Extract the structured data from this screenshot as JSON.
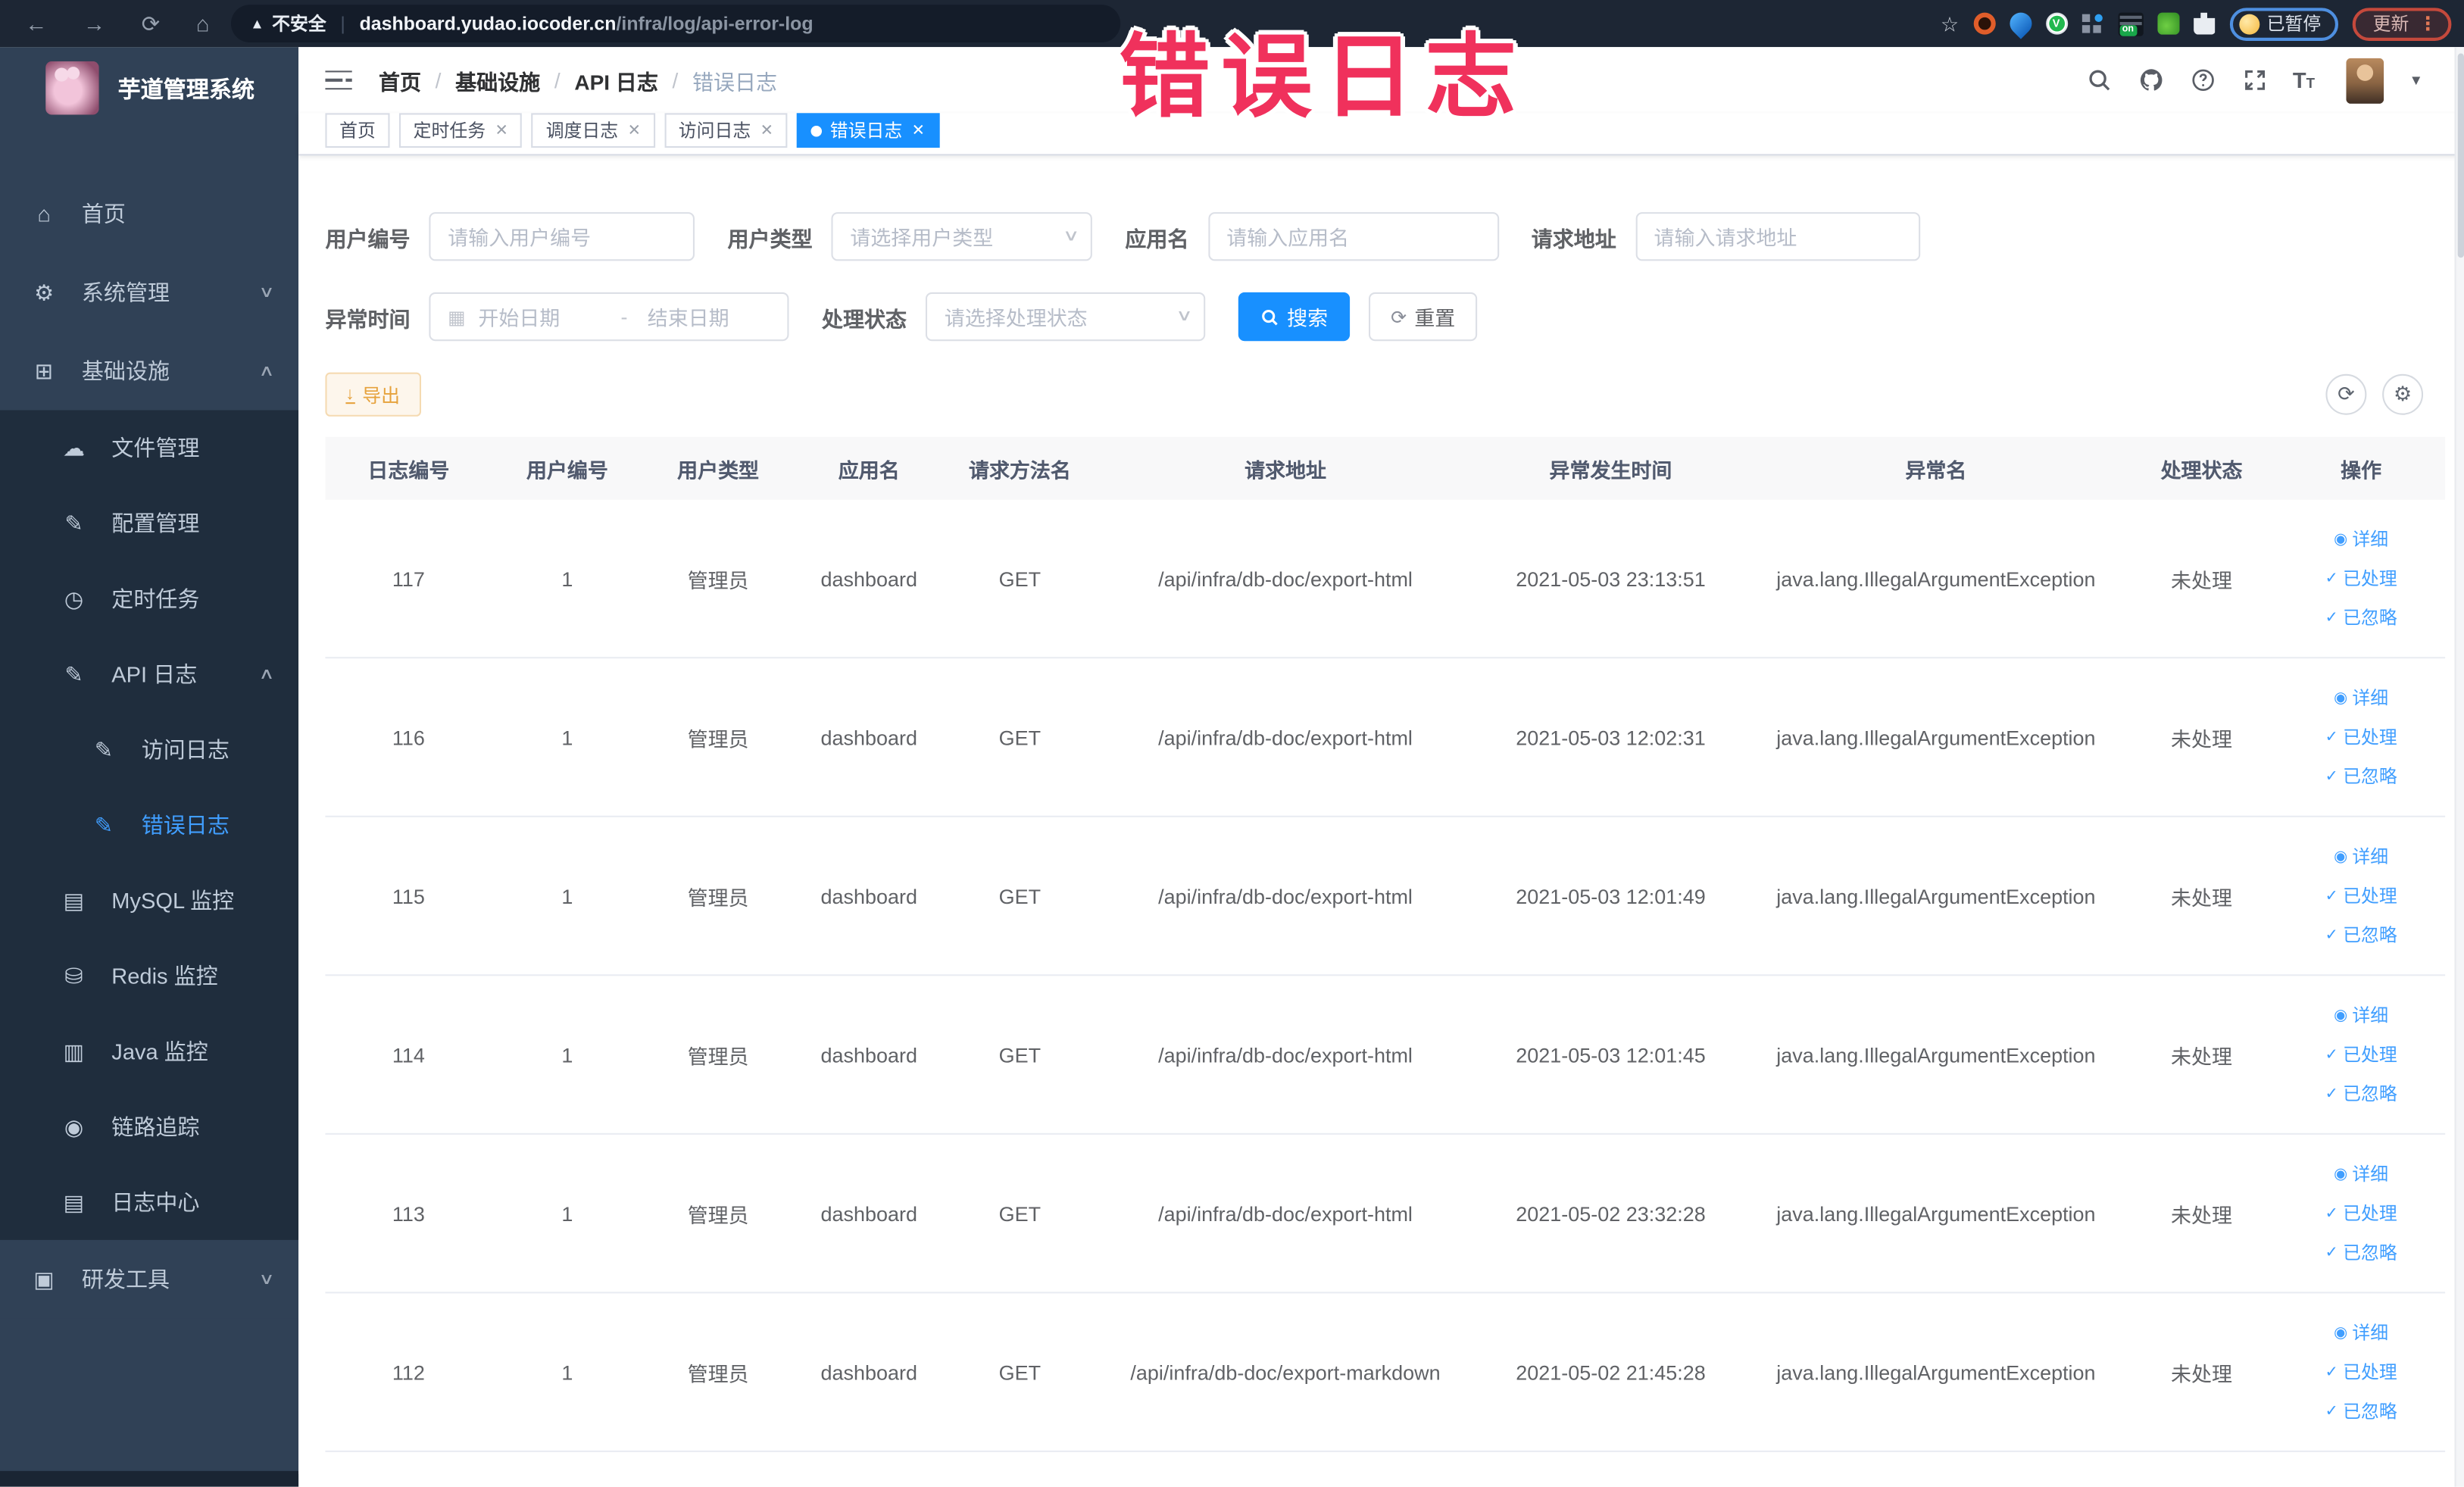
{
  "browser": {
    "security_label": "不安全",
    "url_host": "dashboard.yudao.iocoder.cn",
    "url_path": "/infra/log/api-error-log",
    "paused_badge": "已暂停",
    "update_label": "更新",
    "menu_dots": "⋮"
  },
  "watermark": "错误日志",
  "sidebar": {
    "app_title": "芋道管理系统",
    "items": [
      {
        "label": "首页"
      },
      {
        "label": "系统管理"
      },
      {
        "label": "基础设施"
      },
      {
        "label": "文件管理"
      },
      {
        "label": "配置管理"
      },
      {
        "label": "定时任务"
      },
      {
        "label": "API 日志"
      },
      {
        "label": "访问日志"
      },
      {
        "label": "错误日志"
      },
      {
        "label": "MySQL 监控"
      },
      {
        "label": "Redis 监控"
      },
      {
        "label": "Java 监控"
      },
      {
        "label": "链路追踪"
      },
      {
        "label": "日志中心"
      },
      {
        "label": "研发工具"
      }
    ]
  },
  "breadcrumb": [
    "首页",
    "基础设施",
    "API 日志",
    "错误日志"
  ],
  "tabs": [
    {
      "label": "首页"
    },
    {
      "label": "定时任务"
    },
    {
      "label": "调度日志"
    },
    {
      "label": "访问日志"
    },
    {
      "label": "错误日志"
    }
  ],
  "filters": {
    "user_id_label": "用户编号",
    "user_id_placeholder": "请输入用户编号",
    "user_type_label": "用户类型",
    "user_type_placeholder": "请选择用户类型",
    "app_name_label": "应用名",
    "app_name_placeholder": "请输入应用名",
    "request_url_label": "请求地址",
    "request_url_placeholder": "请输入请求地址",
    "exception_time_label": "异常时间",
    "date_start_placeholder": "开始日期",
    "date_separator": "-",
    "date_end_placeholder": "结束日期",
    "process_status_label": "处理状态",
    "process_status_placeholder": "请选择处理状态",
    "search_label": "搜索",
    "reset_label": "重置"
  },
  "toolbar": {
    "export_label": "导出"
  },
  "table": {
    "headers": [
      "日志编号",
      "用户编号",
      "用户类型",
      "应用名",
      "请求方法名",
      "请求地址",
      "异常发生时间",
      "异常名",
      "处理状态",
      "操作"
    ],
    "action_detail": "详细",
    "action_processed": "已处理",
    "action_ignored": "已忽略",
    "rows": [
      {
        "log_id": "117",
        "user_id": "1",
        "user_type": "管理员",
        "app_name": "dashboard",
        "method": "GET",
        "url": "/api/infra/db-doc/export-html",
        "time": "2021-05-03 23:13:51",
        "exception": "java.lang.IllegalArgumentException",
        "status": "未处理"
      },
      {
        "log_id": "116",
        "user_id": "1",
        "user_type": "管理员",
        "app_name": "dashboard",
        "method": "GET",
        "url": "/api/infra/db-doc/export-html",
        "time": "2021-05-03 12:02:31",
        "exception": "java.lang.IllegalArgumentException",
        "status": "未处理"
      },
      {
        "log_id": "115",
        "user_id": "1",
        "user_type": "管理员",
        "app_name": "dashboard",
        "method": "GET",
        "url": "/api/infra/db-doc/export-html",
        "time": "2021-05-03 12:01:49",
        "exception": "java.lang.IllegalArgumentException",
        "status": "未处理"
      },
      {
        "log_id": "114",
        "user_id": "1",
        "user_type": "管理员",
        "app_name": "dashboard",
        "method": "GET",
        "url": "/api/infra/db-doc/export-html",
        "time": "2021-05-03 12:01:45",
        "exception": "java.lang.IllegalArgumentException",
        "status": "未处理"
      },
      {
        "log_id": "113",
        "user_id": "1",
        "user_type": "管理员",
        "app_name": "dashboard",
        "method": "GET",
        "url": "/api/infra/db-doc/export-html",
        "time": "2021-05-02 23:32:28",
        "exception": "java.lang.IllegalArgumentException",
        "status": "未处理"
      },
      {
        "log_id": "112",
        "user_id": "1",
        "user_type": "管理员",
        "app_name": "dashboard",
        "method": "GET",
        "url": "/api/infra/db-doc/export-markdown",
        "time": "2021-05-02 21:45:28",
        "exception": "java.lang.IllegalArgumentException",
        "status": "未处理"
      }
    ]
  },
  "colors": {
    "primary": "#1890ff",
    "sidebar_bg": "#304156",
    "sidebar_submenu_bg": "#1f2d3d",
    "sidebar_active_text": "#409eff",
    "export_warning": "#e6a23c",
    "watermark_red": "#f0315c",
    "browser_bar_bg": "#1d2634"
  }
}
